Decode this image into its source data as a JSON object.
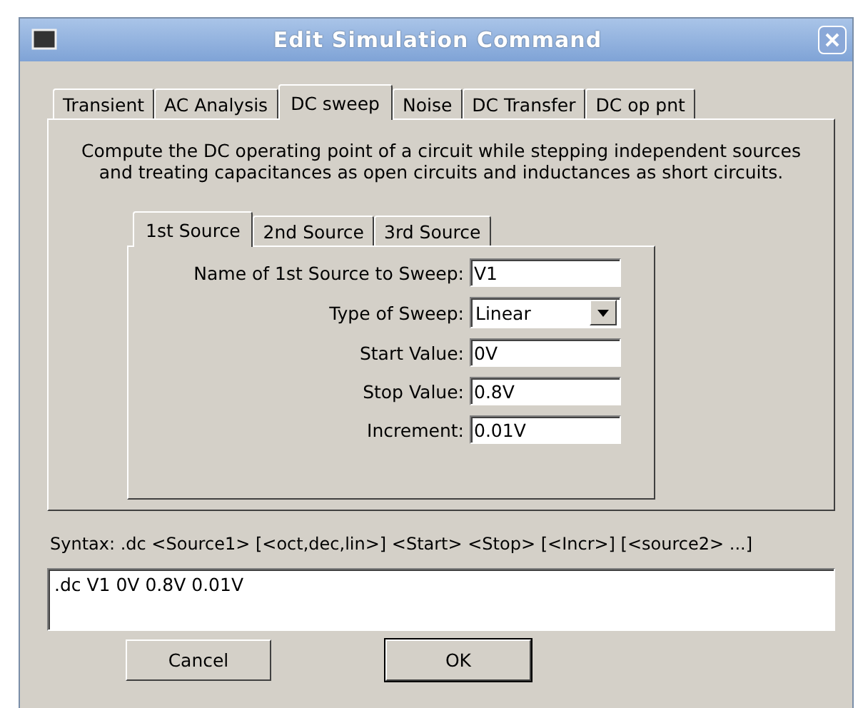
{
  "window": {
    "title": "Edit Simulation Command"
  },
  "tabs": [
    {
      "label": "Transient",
      "selected": false
    },
    {
      "label": "AC Analysis",
      "selected": false
    },
    {
      "label": "DC sweep",
      "selected": true
    },
    {
      "label": "Noise",
      "selected": false
    },
    {
      "label": "DC Transfer",
      "selected": false
    },
    {
      "label": "DC op pnt",
      "selected": false
    }
  ],
  "description": "Compute the DC operating point of a circuit while stepping independent sources and treating capacitances as open circuits and inductances as short circuits.",
  "source_tabs": [
    {
      "label": "1st Source",
      "selected": true
    },
    {
      "label": "2nd Source",
      "selected": false
    },
    {
      "label": "3rd Source",
      "selected": false
    }
  ],
  "fields": [
    {
      "kind": "text",
      "label": "Name of 1st Source to Sweep:",
      "value": "V1"
    },
    {
      "kind": "select",
      "label": "Type of Sweep:",
      "value": "Linear"
    },
    {
      "kind": "text",
      "label": "Start Value:",
      "value": "0V"
    },
    {
      "kind": "text",
      "label": "Stop Value:",
      "value": "0.8V"
    },
    {
      "kind": "text",
      "label": "Increment:",
      "value": "0.01V"
    }
  ],
  "syntax": "Syntax:  .dc <Source1> [<oct,dec,lin>] <Start> <Stop> [<Incr>] [<source2> ...]",
  "command": ".dc V1 0V 0.8V 0.01V",
  "buttons": [
    {
      "label": "Cancel",
      "kind": "normal"
    },
    {
      "label": "OK",
      "kind": "default"
    }
  ]
}
